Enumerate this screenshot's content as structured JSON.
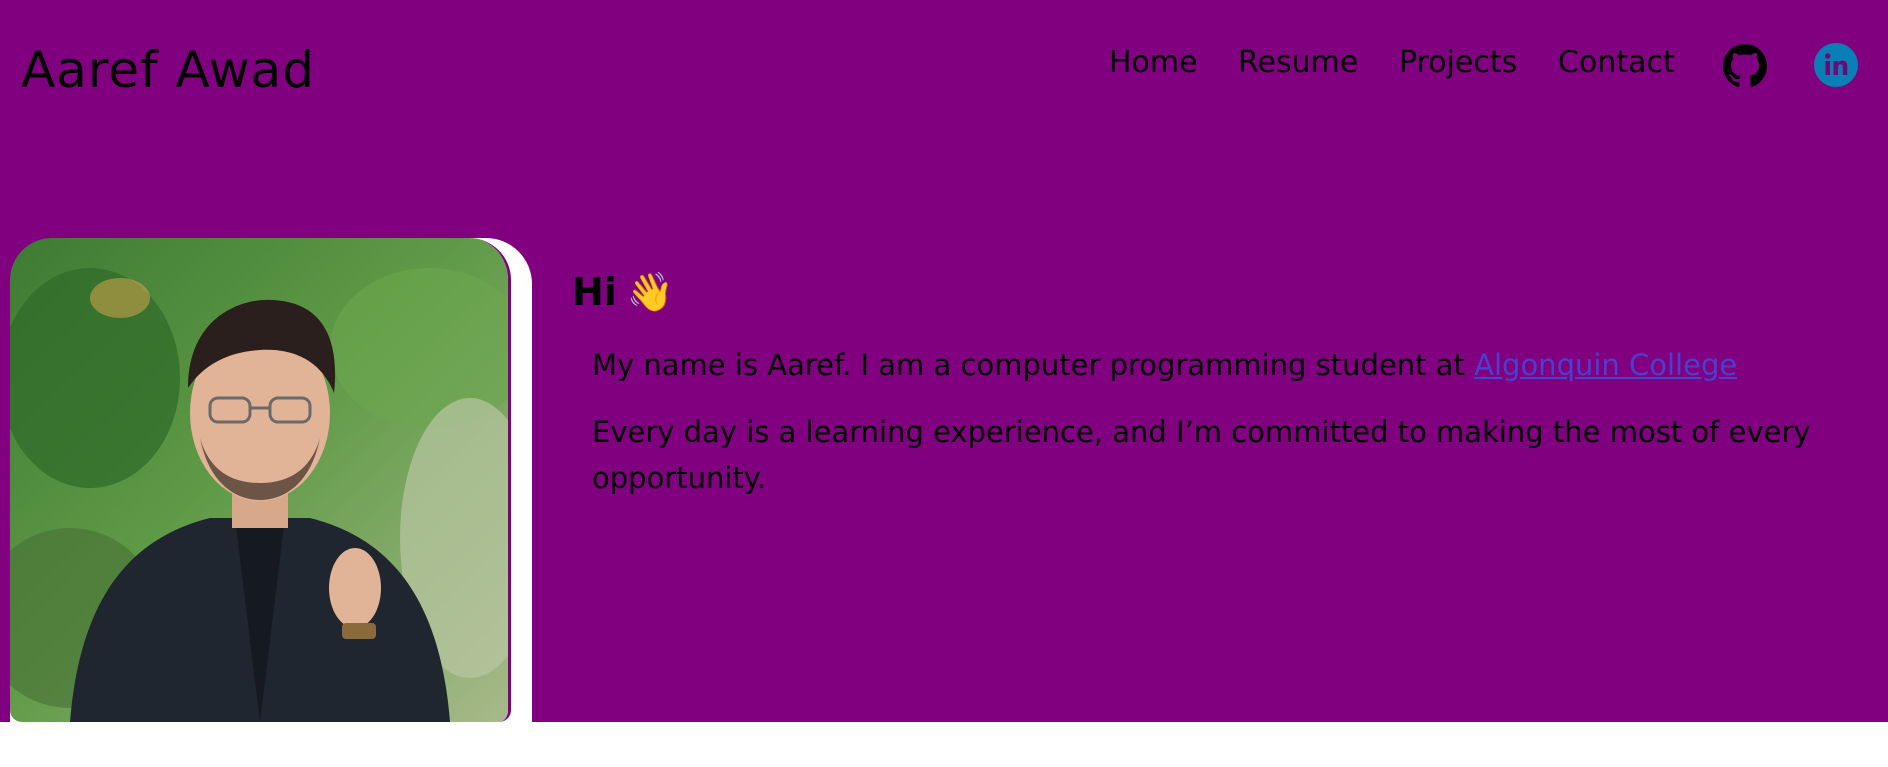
{
  "header": {
    "site_name": "Aaref Awad",
    "nav": [
      {
        "label": "Home"
      },
      {
        "label": "Resume"
      },
      {
        "label": "Projects"
      },
      {
        "label": "Contact"
      }
    ],
    "social": [
      {
        "icon": "github-icon"
      },
      {
        "icon": "linkedin-icon"
      }
    ]
  },
  "hero": {
    "greeting": "Hi",
    "greeting_emoji": "👋",
    "intro_text": "My name is Aaref. I am a computer programming student at ",
    "college_link": "Algonquin College",
    "second_paragraph": "Every day is a learning experience, and I’m committed to making the most of every opportunity."
  },
  "colors": {
    "background": "#800080",
    "text": "#000000",
    "link": "#4a3fcf",
    "linkedin": "#0a7fb5"
  }
}
